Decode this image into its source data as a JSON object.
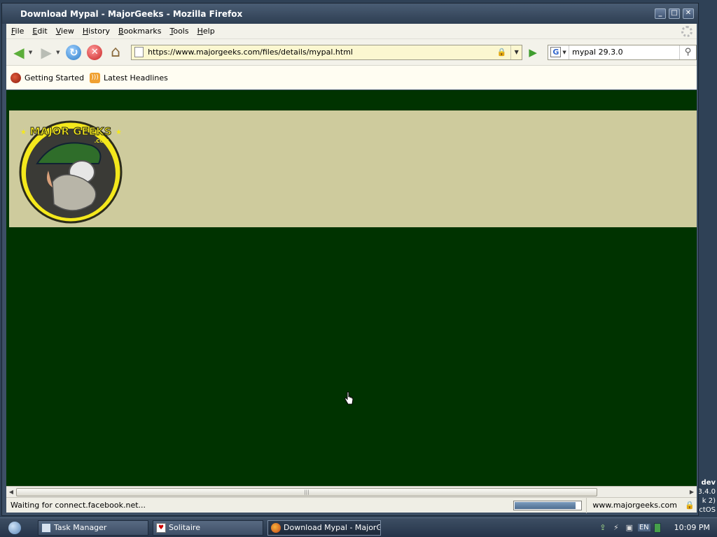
{
  "window": {
    "title": "Download Mypal - MajorGeeks - Mozilla Firefox"
  },
  "menu": [
    "File",
    "Edit",
    "View",
    "History",
    "Bookmarks",
    "Tools",
    "Help"
  ],
  "navbar": {
    "url": "https://www.majorgeeks.com/files/details/mypal.html",
    "search_engine_letter": "G",
    "search_value": "mypal 29.3.0"
  },
  "bookmarks": [
    {
      "label": "Getting Started",
      "icon": "getting-started-icon"
    },
    {
      "label": "Latest Headlines",
      "icon": "rss-feed-icon"
    }
  ],
  "page": {
    "logo_text": "MAJOR GEEKS",
    "logo_sub": ".COM",
    "background_color": "#003300",
    "banner_color": "#cecb9d"
  },
  "status": {
    "text": "Waiting for connect.facebook.net...",
    "progress": 0.92,
    "host": "www.majorgeeks.com"
  },
  "taskbar": {
    "tasks": [
      {
        "label": "Task Manager",
        "active": false
      },
      {
        "label": "Solitaire",
        "active": false
      },
      {
        "label": "Download Mypal - MajorGe...",
        "active": true
      }
    ],
    "language": "EN",
    "clock": "10:09 PM"
  },
  "desktop_text": [
    "dev",
    "3.4.0",
    "k 2)",
    "ctOS"
  ]
}
